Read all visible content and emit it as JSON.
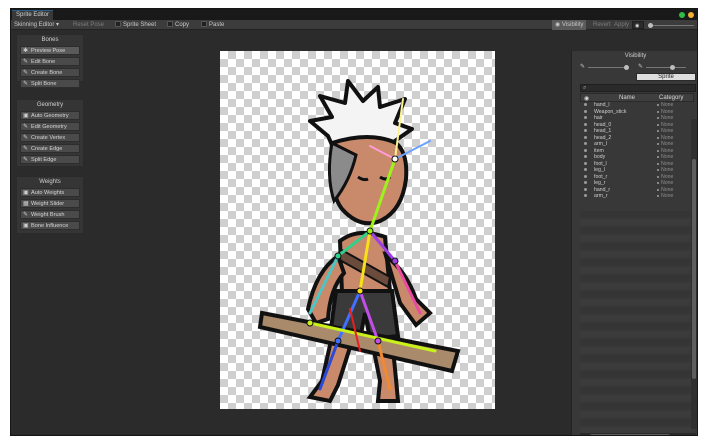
{
  "window": {
    "tab": "Sprite Editor"
  },
  "toolbar": {
    "mode": "Skinning Editor ▾",
    "reset_pose": "Reset Pose",
    "sprite_sheet": "Sprite Sheet",
    "copy": "Copy",
    "paste": "Paste",
    "visibility": "Visibility",
    "revert": "Revert",
    "apply": "Apply"
  },
  "panels": {
    "bones": {
      "title": "Bones",
      "items": [
        "Preview Pose",
        "Edit Bone",
        "Create Bone",
        "Split Bone"
      ]
    },
    "geometry": {
      "title": "Geometry",
      "items": [
        "Auto Geometry",
        "Edit Geometry",
        "Create Vertex",
        "Create Edge",
        "Split Edge"
      ]
    },
    "weights": {
      "title": "Weights",
      "items": [
        "Auto Weights",
        "Weight Slider",
        "Weight Brush",
        "Bone Influence"
      ]
    }
  },
  "visibility_panel": {
    "title": "Visibility",
    "tab": "Sprite",
    "search_placeholder": "⌕",
    "col_name": "Name",
    "col_category": "Category",
    "rows": [
      {
        "name": "hand_l",
        "category": "None"
      },
      {
        "name": "Weapon_stick",
        "category": "None"
      },
      {
        "name": "hair",
        "category": "None"
      },
      {
        "name": "head_0",
        "category": "None"
      },
      {
        "name": "head_1",
        "category": "None"
      },
      {
        "name": "head_2",
        "category": "None"
      },
      {
        "name": "arm_l",
        "category": "None"
      },
      {
        "name": "item",
        "category": "None"
      },
      {
        "name": "body",
        "category": "None"
      },
      {
        "name": "foot_l",
        "category": "None"
      },
      {
        "name": "leg_l",
        "category": "None"
      },
      {
        "name": "foot_r",
        "category": "None"
      },
      {
        "name": "leg_r",
        "category": "None"
      },
      {
        "name": "hand_r",
        "category": "None"
      },
      {
        "name": "arm_r",
        "category": "None"
      }
    ]
  },
  "colors": {
    "accent": "#2c5d87",
    "window_bg": "#282828",
    "panel_bg": "#353535"
  }
}
